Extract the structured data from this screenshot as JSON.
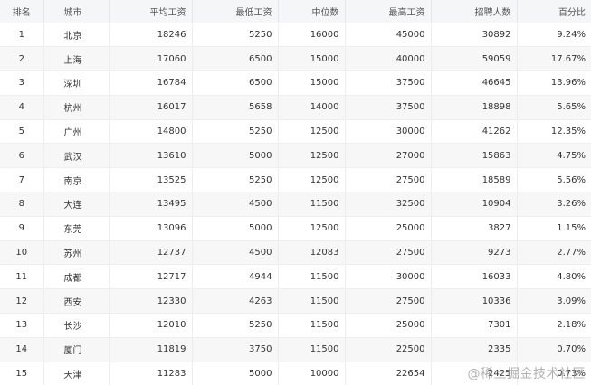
{
  "table": {
    "headers": [
      "排名",
      "城市",
      "平均工资",
      "最低工资",
      "中位数",
      "最高工资",
      "招聘人数",
      "百分比"
    ],
    "rows": [
      [
        "1",
        "北京",
        "18246",
        "5250",
        "16000",
        "45000",
        "30892",
        "9.24%"
      ],
      [
        "2",
        "上海",
        "17060",
        "6500",
        "15000",
        "40000",
        "59059",
        "17.67%"
      ],
      [
        "3",
        "深圳",
        "16784",
        "6500",
        "15000",
        "37500",
        "46645",
        "13.96%"
      ],
      [
        "4",
        "杭州",
        "16017",
        "5658",
        "14000",
        "37500",
        "18898",
        "5.65%"
      ],
      [
        "5",
        "广州",
        "14800",
        "5250",
        "12500",
        "30000",
        "41262",
        "12.35%"
      ],
      [
        "6",
        "武汉",
        "13610",
        "5000",
        "12500",
        "27000",
        "15863",
        "4.75%"
      ],
      [
        "7",
        "南京",
        "13525",
        "5250",
        "12500",
        "27500",
        "18589",
        "5.56%"
      ],
      [
        "8",
        "大连",
        "13495",
        "4500",
        "11500",
        "32500",
        "10904",
        "3.26%"
      ],
      [
        "9",
        "东莞",
        "13096",
        "5000",
        "12500",
        "25000",
        "3827",
        "1.15%"
      ],
      [
        "10",
        "苏州",
        "12737",
        "4500",
        "12083",
        "27500",
        "9273",
        "2.77%"
      ],
      [
        "11",
        "成都",
        "12717",
        "4944",
        "11500",
        "30000",
        "16033",
        "4.80%"
      ],
      [
        "12",
        "西安",
        "12330",
        "4263",
        "11500",
        "27500",
        "10336",
        "3.09%"
      ],
      [
        "13",
        "长沙",
        "12010",
        "5250",
        "11500",
        "25000",
        "7301",
        "2.18%"
      ],
      [
        "14",
        "厦门",
        "11819",
        "3750",
        "11500",
        "22500",
        "2335",
        "0.70%"
      ],
      [
        "15",
        "天津",
        "11283",
        "5000",
        "10000",
        "22654",
        "2425",
        "0.73%"
      ]
    ]
  },
  "watermark": "@稀土掘金技术社区"
}
